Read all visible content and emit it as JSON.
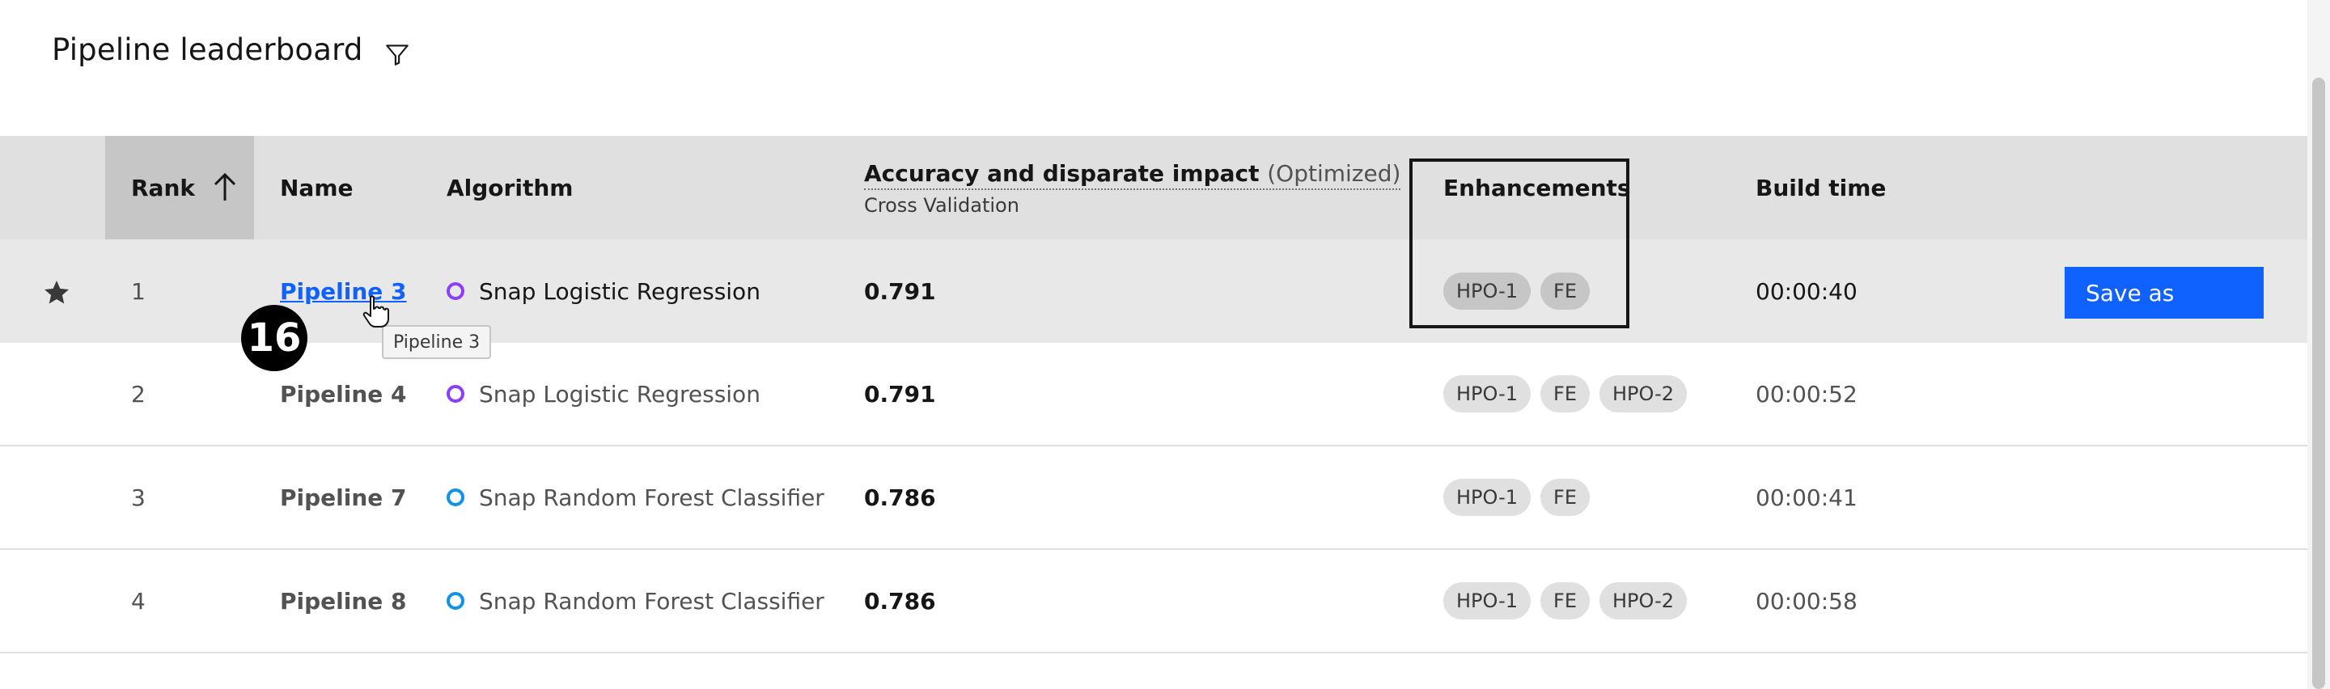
{
  "page": {
    "title": "Pipeline leaderboard",
    "filter_icon": "filter-icon"
  },
  "table": {
    "columns": {
      "rank": "Rank",
      "name": "Name",
      "algorithm": "Algorithm",
      "metric_title": "Accuracy and disparate impact",
      "metric_suffix": "(Optimized)",
      "metric_sub": "Cross Validation",
      "enhancements": "Enhancements",
      "build_time": "Build time"
    },
    "sort_icon": "arrow-up-icon",
    "rows": [
      {
        "rank": "1",
        "name": "Pipeline 3",
        "algorithm": "Snap Logistic Regression",
        "score": "0.791",
        "tags": [
          "HPO-1",
          "FE"
        ],
        "build_time": "00:00:40",
        "starred": true,
        "algo_color": "#8a3ffc"
      },
      {
        "rank": "2",
        "name": "Pipeline 4",
        "algorithm": "Snap Logistic Regression",
        "score": "0.791",
        "tags": [
          "HPO-1",
          "FE",
          "HPO-2"
        ],
        "build_time": "00:00:52",
        "starred": false,
        "algo_color": "#8a3ffc"
      },
      {
        "rank": "3",
        "name": "Pipeline 7",
        "algorithm": "Snap Random Forest Classifier",
        "score": "0.786",
        "tags": [
          "HPO-1",
          "FE"
        ],
        "build_time": "00:00:41",
        "starred": false,
        "algo_color": "#1192e8"
      },
      {
        "rank": "4",
        "name": "Pipeline 8",
        "algorithm": "Snap Random Forest Classifier",
        "score": "0.786",
        "tags": [
          "HPO-1",
          "FE",
          "HPO-2"
        ],
        "build_time": "00:00:58",
        "starred": false,
        "algo_color": "#1192e8"
      }
    ]
  },
  "actions": {
    "save_as": "Save as"
  },
  "tooltip": {
    "text": "Pipeline 3"
  },
  "annotation": {
    "step": "16"
  },
  "colors": {
    "accent": "#0f62fe",
    "header_bg": "#e0e0e0",
    "selected_row_bg": "#e8e8e8"
  }
}
